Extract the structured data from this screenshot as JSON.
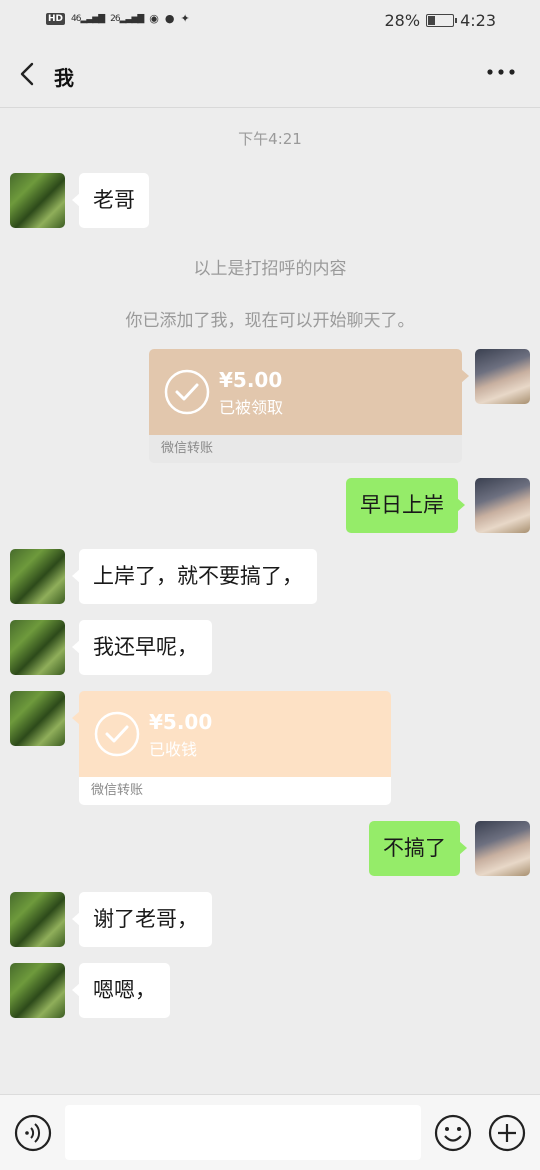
{
  "status_bar": {
    "hd": "HD",
    "signal1": "46",
    "signal2": "26",
    "battery_percent": "28%",
    "battery_level": 0.28,
    "time": "4:23"
  },
  "header": {
    "title": "我"
  },
  "chat": {
    "timestamp": "下午4:21",
    "messages": [
      {
        "text": "老哥"
      },
      {
        "text": "早日上岸"
      },
      {
        "text": "上岸了，就不要搞了，"
      },
      {
        "text": "我还早呢，"
      },
      {
        "text": "不搞了"
      },
      {
        "text": "谢了老哥，"
      },
      {
        "text": "嗯嗯，"
      }
    ],
    "system_greeting": "以上是打招呼的内容",
    "system_added": "你已添加了我，现在可以开始聊天了。",
    "transfers": [
      {
        "amount": "¥5.00",
        "status": "已被领取",
        "footer": "微信转账"
      },
      {
        "amount": "¥5.00",
        "status": "已收钱",
        "footer": "微信转账"
      }
    ]
  },
  "input_bar": {
    "placeholder": ""
  },
  "icons": {
    "back": "back-arrow-icon",
    "more": "more-icon",
    "voice": "voice-icon",
    "emoji": "emoji-icon",
    "plus": "plus-icon"
  }
}
